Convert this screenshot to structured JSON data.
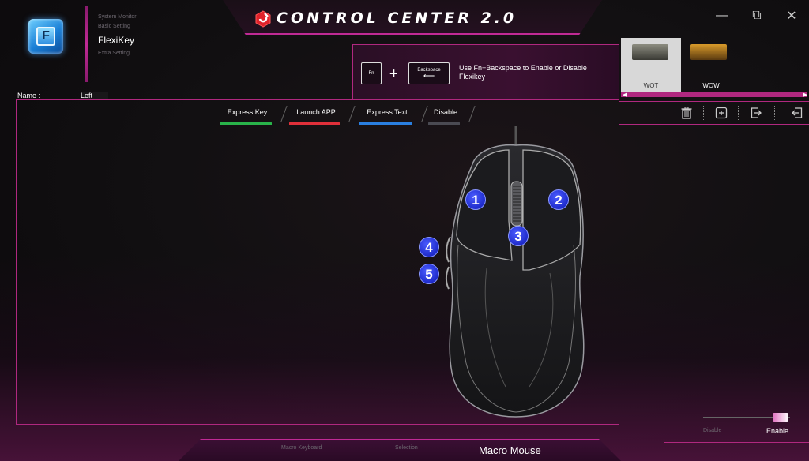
{
  "sidebar": {
    "nav": [
      "System Monitor",
      "Basic Setting",
      "FlexiKey",
      "Extra Setting"
    ],
    "active_index": 2
  },
  "name_field": {
    "label": "Name :",
    "value": "Left"
  },
  "header": {
    "title": "CONTROL CENTER 2.0"
  },
  "window_controls": {
    "minimize": "—",
    "restore": "⧉",
    "close": "✕"
  },
  "hint": {
    "fn_key": "Fn",
    "backspace_key": "Backspace",
    "arrow": "⟵",
    "plus": "+",
    "text": "Use Fn+Backspace to Enable or Disable Flexikey"
  },
  "profiles": [
    {
      "label": "WOT",
      "selected": true,
      "color": "#6a6a60"
    },
    {
      "label": "WOW",
      "selected": false,
      "color": "#b07818"
    }
  ],
  "toolbar": [
    "trash-icon",
    "add-icon",
    "export-icon",
    "import-icon"
  ],
  "tabs": [
    {
      "label": "Express Key",
      "color": "#29b34a"
    },
    {
      "label": "Launch APP",
      "color": "#e0303a"
    },
    {
      "label": "Express Text",
      "color": "#2a7fe0"
    },
    {
      "label": "Disable",
      "color": "#4a4a52"
    }
  ],
  "mouse_buttons": [
    "1",
    "2",
    "3",
    "4",
    "5"
  ],
  "toggle": {
    "disable": "Disable",
    "enable": "Enable",
    "state": "Enable"
  },
  "bottom_nav": [
    "Macro Keyboard",
    "Selection",
    "Macro Mouse"
  ],
  "bottom_active": 2,
  "colors": {
    "accent": "#c02a95",
    "badge": "#1f2ccc"
  }
}
